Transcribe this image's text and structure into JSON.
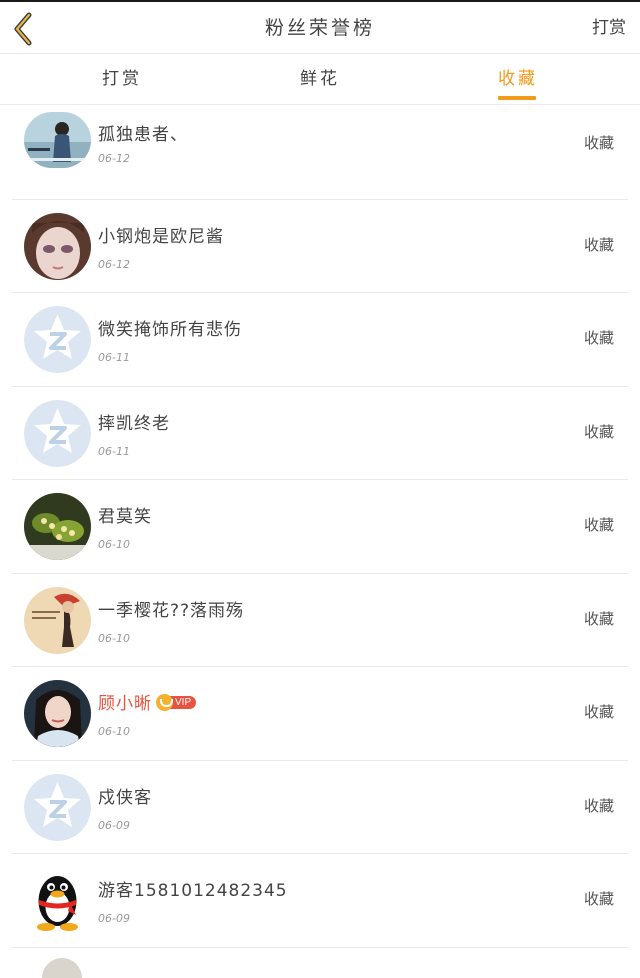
{
  "header": {
    "title": "粉丝荣誉榜",
    "right_action": "打赏"
  },
  "tabs": [
    {
      "label": "打赏",
      "active": false
    },
    {
      "label": "鲜花",
      "active": false
    },
    {
      "label": "收藏",
      "active": true
    }
  ],
  "colors": {
    "accent": "#f29a1b",
    "vip_red": "#e8533f"
  },
  "rows": [
    {
      "name": "孤独患者、",
      "date": "06-12",
      "action": "收藏",
      "avatar": "photo-avatar"
    },
    {
      "name": "小钢炮是欧尼酱",
      "date": "06-12",
      "action": "收藏",
      "avatar": "photo-avatar"
    },
    {
      "name": "微笑掩饰所有悲伤",
      "date": "06-11",
      "action": "收藏",
      "avatar": "default-star-avatar"
    },
    {
      "name": "摔凯终老",
      "date": "06-11",
      "action": "收藏",
      "avatar": "default-star-avatar"
    },
    {
      "name": "君莫笑",
      "date": "06-10",
      "action": "收藏",
      "avatar": "photo-avatar"
    },
    {
      "name": "一季樱花??落雨殇",
      "date": "06-10",
      "action": "收藏",
      "avatar": "photo-avatar"
    },
    {
      "name": "顾小晰",
      "date": "06-10",
      "action": "收藏",
      "avatar": "photo-avatar",
      "vip": "VIP"
    },
    {
      "name": "戍侠客",
      "date": "06-09",
      "action": "收藏",
      "avatar": "default-star-avatar"
    },
    {
      "name": "游客1581012482345",
      "date": "06-09",
      "action": "收藏",
      "avatar": "qq-penguin-avatar"
    }
  ]
}
